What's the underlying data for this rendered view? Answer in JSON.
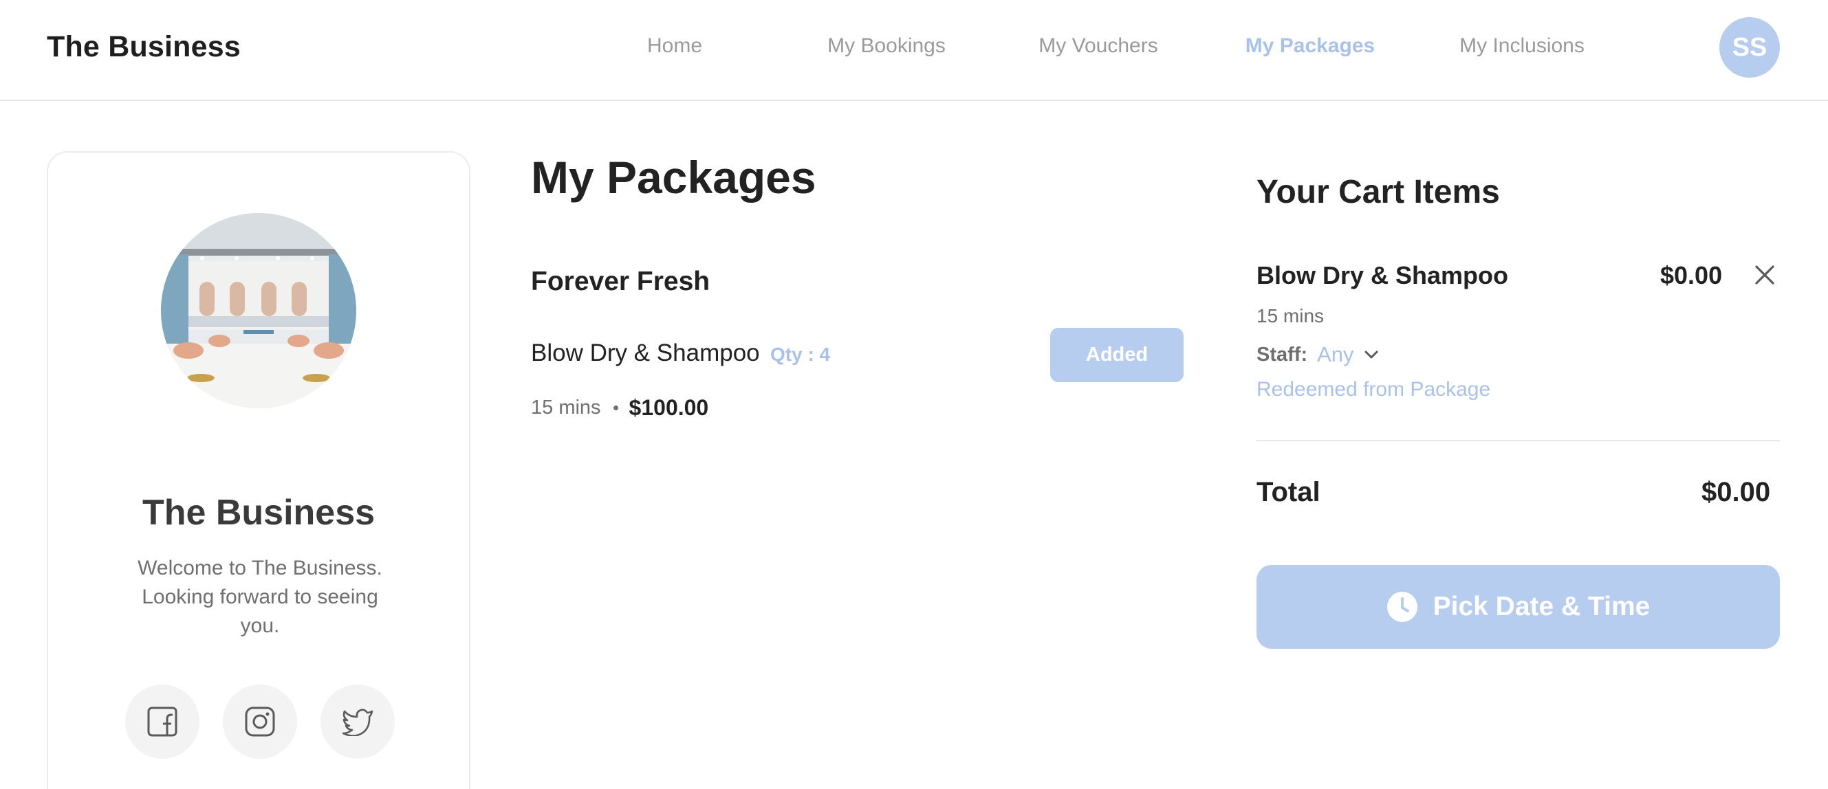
{
  "header": {
    "brand": "The Business",
    "nav": [
      {
        "label": "Home",
        "active": false
      },
      {
        "label": "My Bookings",
        "active": false
      },
      {
        "label": "My Vouchers",
        "active": false
      },
      {
        "label": "My Packages",
        "active": true
      },
      {
        "label": "My Inclusions",
        "active": false
      }
    ],
    "avatar_initials": "SS"
  },
  "profile": {
    "title": "The Business",
    "description": "Welcome to The Business. Looking forward to seeing you.",
    "social": [
      "facebook-icon",
      "instagram-icon",
      "twitter-icon"
    ]
  },
  "packages": {
    "page_title": "My Packages",
    "items": [
      {
        "name": "Forever Fresh",
        "services": [
          {
            "name": "Blow Dry & Shampoo",
            "qty": "Qty : 4",
            "duration": "15 mins",
            "price": "$100.00",
            "button": "Added"
          }
        ]
      }
    ]
  },
  "cart": {
    "title": "Your Cart Items",
    "items": [
      {
        "name": "Blow Dry & Shampoo",
        "price": "$0.00",
        "duration": "15 mins",
        "staff_label": "Staff:",
        "staff_value": "Any",
        "note": "Redeemed from Package"
      }
    ],
    "total_label": "Total",
    "total_value": "$0.00",
    "cta": "Pick Date & Time"
  },
  "colors": {
    "accent": "#b7cdf0",
    "accent_text": "#a9c2ec",
    "muted": "#9a9a9a"
  }
}
